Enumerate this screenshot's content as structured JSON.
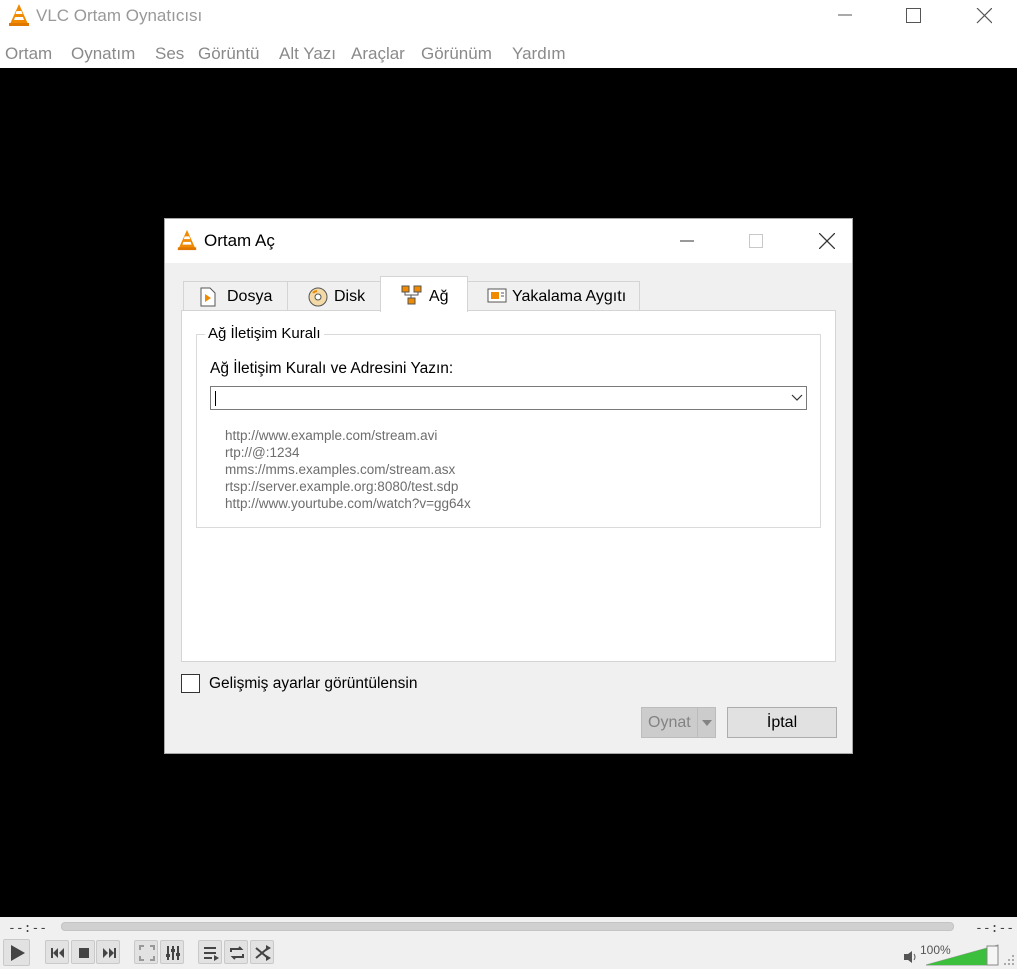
{
  "window": {
    "title": "VLC Ortam Oynatıcısı"
  },
  "menu": [
    "Ortam",
    "Oynatım",
    "Ses",
    "Görüntü",
    "Alt Yazı",
    "Araçlar",
    "Görünüm",
    "Yardım"
  ],
  "dialog": {
    "title": "Ortam Aç",
    "tabs": [
      {
        "label": "Dosya",
        "icon": "file-icon"
      },
      {
        "label": "Disk",
        "icon": "disc-icon"
      },
      {
        "label": "Ağ",
        "icon": "network-icon",
        "active": true
      },
      {
        "label": "Yakalama Aygıtı",
        "icon": "capture-device-icon"
      }
    ],
    "group_title": "Ağ İletişim Kuralı",
    "url_label": "Ağ İletişim Kuralı ve Adresini Yazın:",
    "url_value": "",
    "examples": [
      "http://www.example.com/stream.avi",
      "rtp://@:1234",
      "mms://mms.examples.com/stream.asx",
      "rtsp://server.example.org:8080/test.sdp",
      "http://www.yourtube.com/watch?v=gg64x"
    ],
    "advanced_checkbox_label": "Gelişmiş ayarlar görüntülensin",
    "advanced_checked": false,
    "play_button": "Oynat",
    "cancel_button": "İptal"
  },
  "player": {
    "time_elapsed": "--:--",
    "time_total": "--:--",
    "volume": "100%",
    "volume_level": 1.0
  },
  "colors": {
    "accent_orange": "#f08a00",
    "volume_green": "#3cbf3c",
    "video_bg": "#000000"
  }
}
